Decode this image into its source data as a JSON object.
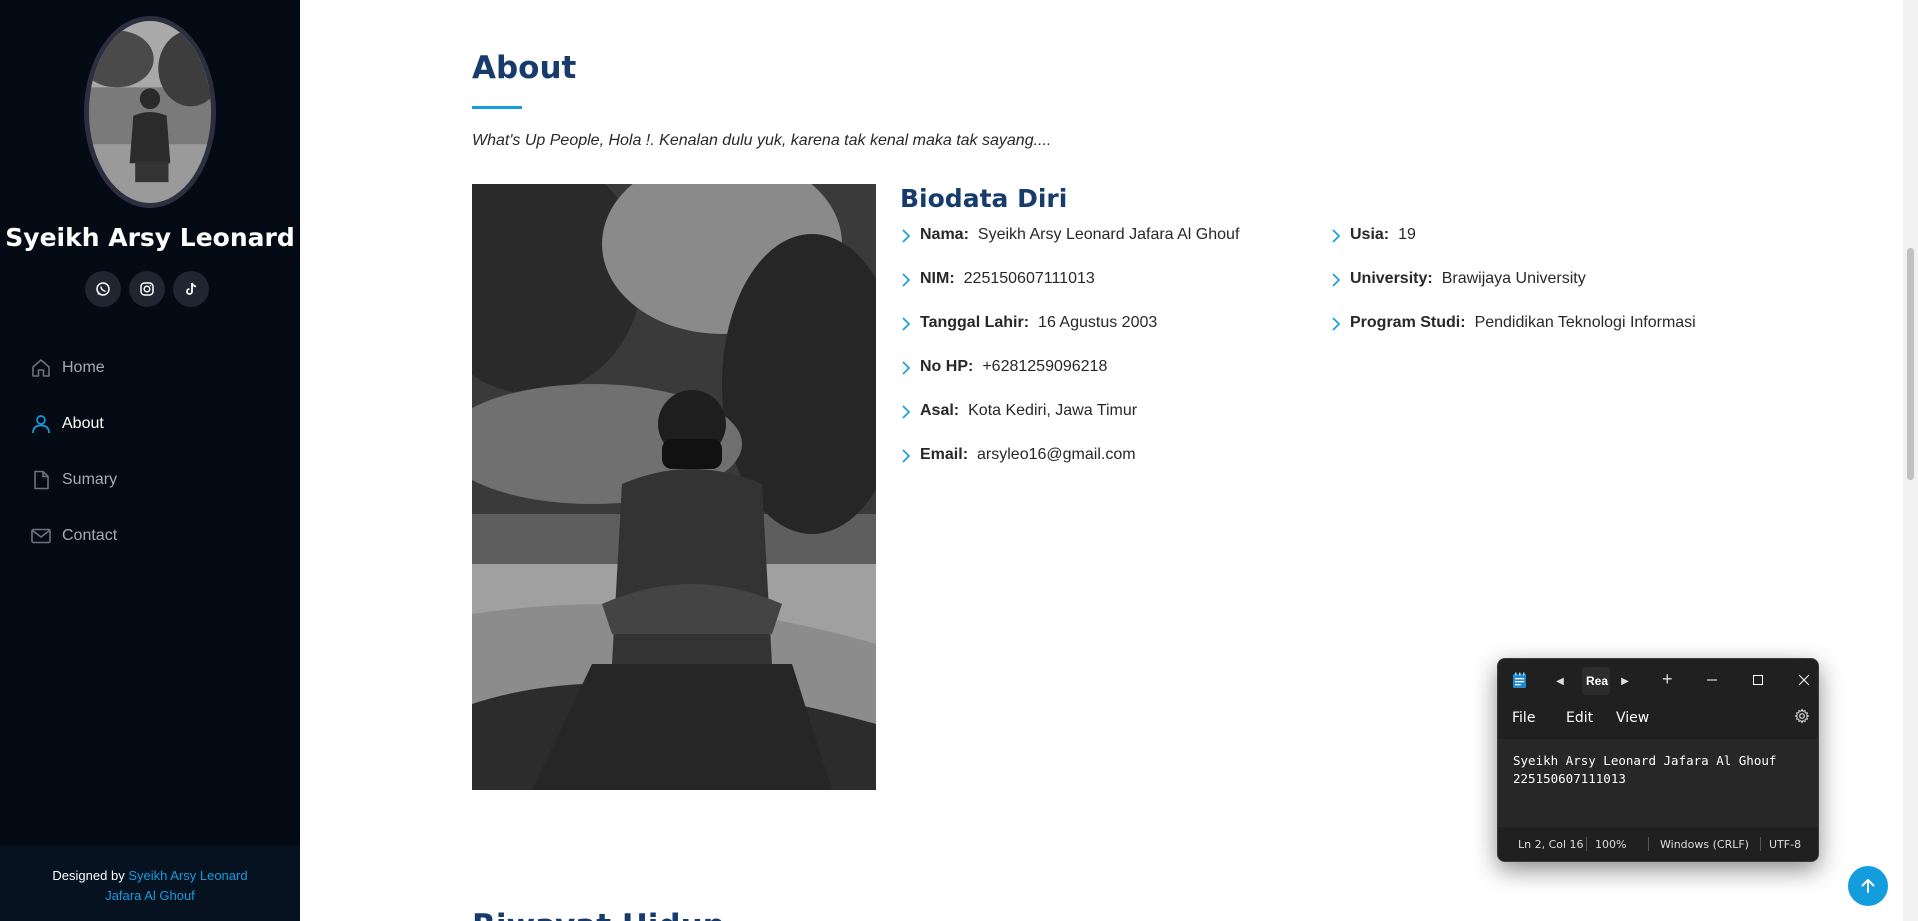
{
  "sidebar": {
    "profile_name": "Syeikh Arsy Leonard",
    "social": [
      {
        "icon": "whatsapp-icon"
      },
      {
        "icon": "instagram-icon"
      },
      {
        "icon": "tiktok-icon"
      }
    ],
    "nav": [
      {
        "label": "Home",
        "icon": "house-icon",
        "active": false
      },
      {
        "label": "About",
        "icon": "person-icon",
        "active": true
      },
      {
        "label": "Sumary",
        "icon": "file-icon",
        "active": false
      },
      {
        "label": "Contact",
        "icon": "envelope-icon",
        "active": false
      }
    ],
    "footer": {
      "prefix": "Designed by",
      "link_line1": "Syeikh Arsy Leonard",
      "link_line2": "Jafara Al Ghouf"
    }
  },
  "about": {
    "title": "About",
    "intro": "What's Up People, Hola !. Kenalan dulu yuk, karena tak kenal maka tak sayang....",
    "bio_title": "Biodata Diri",
    "left": [
      {
        "label": "Nama:",
        "value": "Syeikh Arsy Leonard Jafara Al Ghouf"
      },
      {
        "label": "NIM:",
        "value": "225150607111013"
      },
      {
        "label": "Tanggal Lahir:",
        "value": "16 Agustus 2003"
      },
      {
        "label": "No HP:",
        "value": "+6281259096218"
      },
      {
        "label": "Asal:",
        "value": "Kota Kediri, Jawa Timur"
      },
      {
        "label": "Email:",
        "value": "arsyleo16@gmail.com"
      }
    ],
    "right": [
      {
        "label": "Usia:",
        "value": "19"
      },
      {
        "label": "University:",
        "value": "Brawijaya University"
      },
      {
        "label": "Program Studi:",
        "value": "Pendidikan Teknologi Informasi"
      }
    ],
    "next_heading": "Riwayat Hidup"
  },
  "notepad": {
    "tab_label": "Rea",
    "menu": [
      "File",
      "Edit",
      "View"
    ],
    "content_line1": "Syeikh Arsy Leonard Jafara Al Ghouf",
    "content_line2": "225150607111013",
    "status": {
      "position": "Ln 2, Col 16",
      "zoom": "100%",
      "line_ending": "Windows (CRLF)",
      "encoding": "UTF-8"
    }
  },
  "colors": {
    "sidebar_bg": "#040b14",
    "accent": "#149ddd",
    "heading": "#173b6c"
  }
}
